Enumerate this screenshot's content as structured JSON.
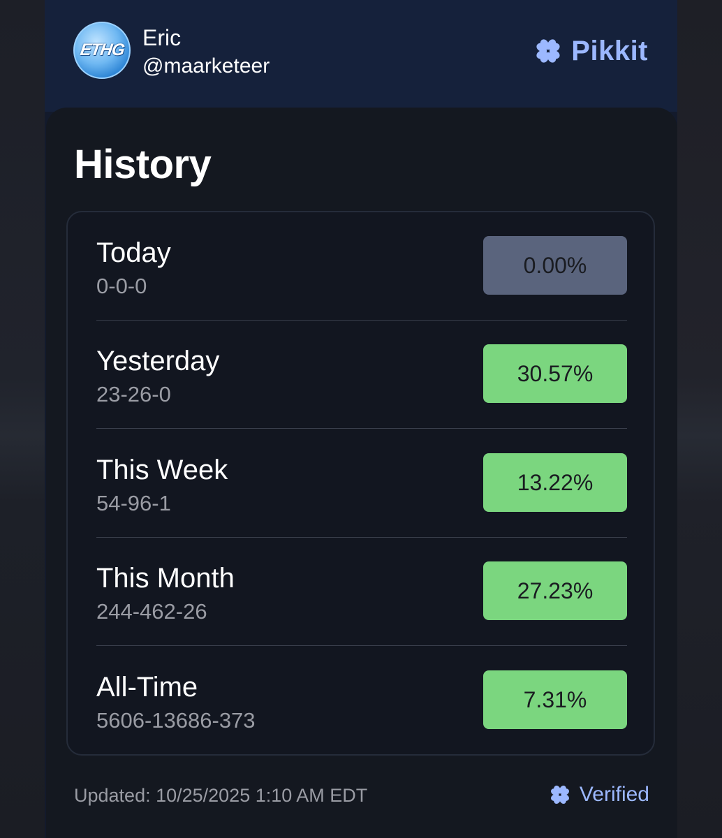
{
  "user": {
    "avatar_text": "ETHG",
    "name": "Eric",
    "handle": "@maarketeer"
  },
  "brand": {
    "icon": "clover-icon",
    "name": "Pikkit",
    "color": "#9cb8ff"
  },
  "history": {
    "title": "History",
    "rows": [
      {
        "label": "Today",
        "record": "0-0-0",
        "percent": "0.00%",
        "status": "neutral"
      },
      {
        "label": "Yesterday",
        "record": "23-26-0",
        "percent": "30.57%",
        "status": "positive"
      },
      {
        "label": "This Week",
        "record": "54-96-1",
        "percent": "13.22%",
        "status": "positive"
      },
      {
        "label": "This Month",
        "record": "244-462-26",
        "percent": "27.23%",
        "status": "positive"
      },
      {
        "label": "All-Time",
        "record": "5606-13686-373",
        "percent": "7.31%",
        "status": "positive"
      }
    ]
  },
  "footer": {
    "updated": "Updated: 10/25/2025 1:10 AM EDT",
    "verified_icon": "clover-icon",
    "verified_label": "Verified"
  },
  "colors": {
    "positive": "#7bd67f",
    "neutral": "#5a647d",
    "accent": "#9cb8ff"
  }
}
